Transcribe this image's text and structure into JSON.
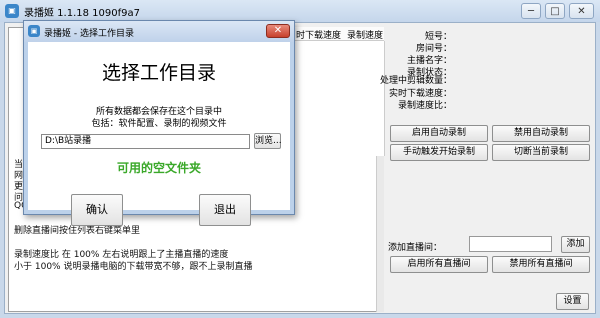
{
  "main_window": {
    "title": "录播姬 1.1.18 1090f9a7",
    "controls": {
      "minimize": "─",
      "maximize": "□",
      "close": "✕"
    }
  },
  "grid": {
    "columns": [
      "时下载速度",
      "录制速度"
    ]
  },
  "log": {
    "lines": [
      "当前",
      "网站",
      "更新",
      "问题",
      "QQ",
      "删除直播间按住列表右键菜单里",
      "",
      "录制速度比 在 100% 左右说明跟上了主播直播的速度",
      "小于 100% 说明录播电脑的下载带宽不够，跟不上录制直播"
    ]
  },
  "info_panel": {
    "labels": [
      "短号：",
      "房间号：",
      "主播名字：",
      "录制状态：",
      "处理中剪辑数量：",
      "实时下载速度：",
      "录制速度比："
    ]
  },
  "buttons": {
    "enable_auto_record": "启用自动录制",
    "disable_auto_record": "禁用自动录制",
    "manual_start": "手动触发开始录制",
    "switch_record": "切断当前录制",
    "add": "添加",
    "enable_all": "启用所有直播间",
    "disable_all": "禁用所有直播间",
    "settings": "设置"
  },
  "add_room": {
    "label": "添加直播间：",
    "value": ""
  },
  "dialog": {
    "title": "录播姬 - 选择工作目录",
    "close": "✕",
    "heading": "选择工作目录",
    "desc1": "所有数据都会保存在这个目录中",
    "desc2": "包括：软件配置、录制的视频文件",
    "path": "D:\\B站录播",
    "browse": "浏览...",
    "status": "可用的空文件夹",
    "confirm": "确认",
    "exit": "退出"
  },
  "colors": {
    "status_green": "#3aa829",
    "dialog_border": "#6b88ad"
  }
}
